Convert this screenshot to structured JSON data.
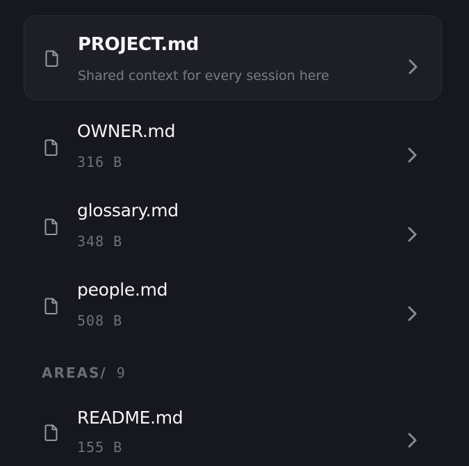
{
  "files": [
    {
      "name": "PROJECT.md",
      "detail": "Shared context for every session here"
    },
    {
      "name": "OWNER.md",
      "detail": "316 B"
    },
    {
      "name": "glossary.md",
      "detail": "348 B"
    },
    {
      "name": "people.md",
      "detail": "508 B"
    }
  ],
  "section": {
    "label": "AREAS/",
    "count": "9"
  },
  "area_files": [
    {
      "name": "README.md",
      "detail": "155 B"
    }
  ],
  "icons": {
    "file": "file-icon",
    "chevron": "chevron-right-icon"
  },
  "colors": {
    "background": "#17171f",
    "card": "#1e1e27",
    "text": "#f6f6f8",
    "muted": "#7c7c88"
  }
}
